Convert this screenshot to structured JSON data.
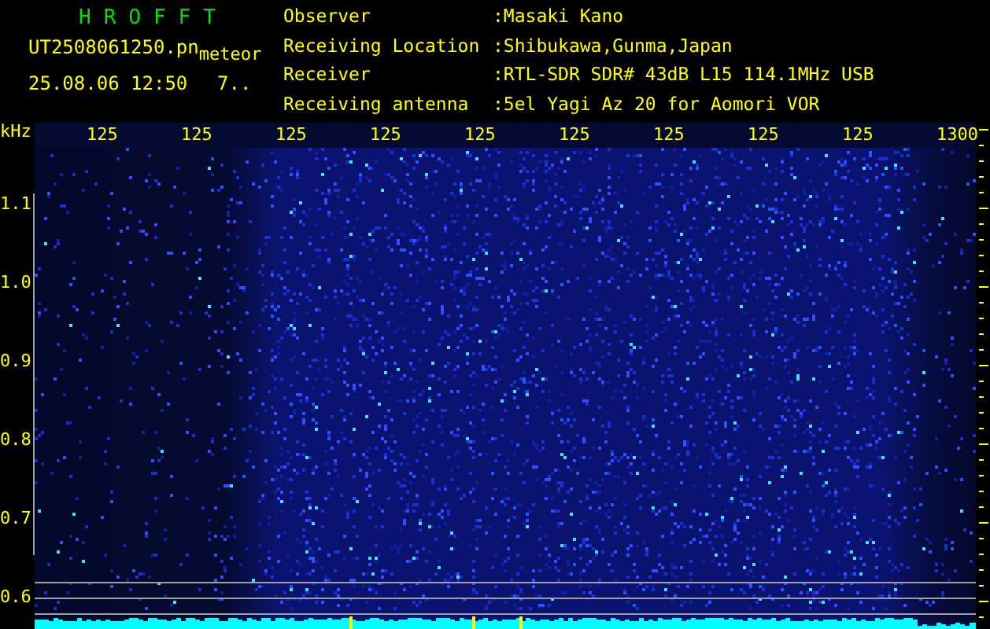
{
  "header": {
    "title": "HROFFT",
    "file_name": "UT2508061250.pn",
    "tag": "meteor",
    "timestamp": "25.08.06 12:50",
    "count": "7..",
    "info": [
      {
        "label": "Observer",
        "value": ":Masaki Kano"
      },
      {
        "label": "Receiving Location",
        "value": ":Shibukawa,Gunma,Japan"
      },
      {
        "label": "Receiver",
        "value": ":RTL-SDR SDR# 43dB L15 114.1MHz USB"
      },
      {
        "label": "Receiving antenna",
        "value": ":5el Yagi Az 20 for Aomori VOR"
      }
    ]
  },
  "plot": {
    "y_unit": "kHz",
    "x_ticks": [
      "125",
      "125",
      "125",
      "125",
      "125",
      "125",
      "125",
      "125",
      "125",
      "1300"
    ],
    "y_ticks": [
      "1.1",
      "1.0",
      "0.9",
      "0.8",
      "0.7",
      "0.6"
    ]
  }
}
